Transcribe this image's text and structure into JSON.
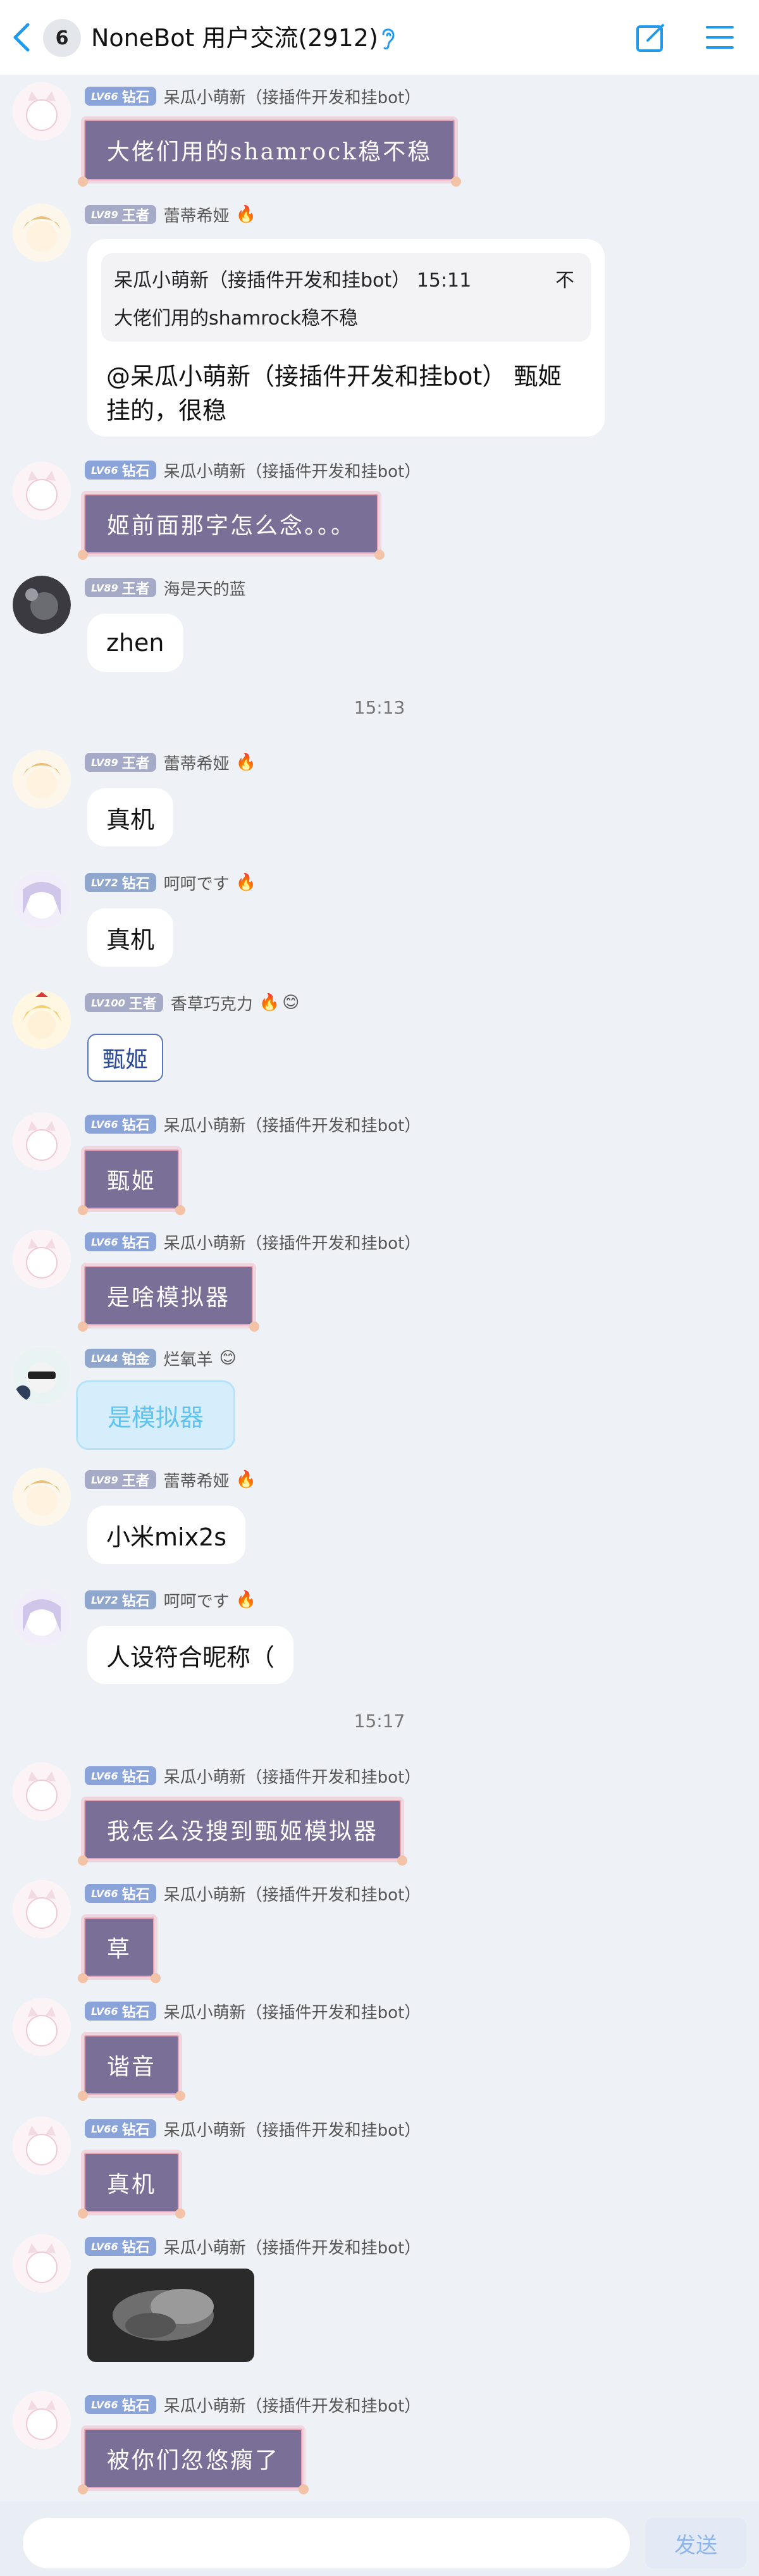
{
  "header": {
    "unread": "6",
    "title": "NoneBot 用户交流(2912)"
  },
  "colors": {
    "accent": "#1e9bf0",
    "background": "#eef1f6",
    "purple_bubble": "#7a6f96"
  },
  "messages": [
    {
      "level": "LV66",
      "rank": "钻石",
      "name": "呆瓜小萌新（接插件开发和挂bot）",
      "text": "大佬们用的shamrock稳不稳"
    },
    {
      "level": "LV89",
      "rank": "王者",
      "name": "蕾蒂希娅",
      "quote_head": "呆瓜小萌新（接插件开发和挂bot）  15:11",
      "quote_body": "大佬们用的shamrock稳不稳",
      "quote_no": "不",
      "text1": "@呆瓜小萌新（接插件开发和挂bot） 甄姬",
      "text2": "挂的，很稳"
    },
    {
      "level": "LV66",
      "rank": "钻石",
      "name": "呆瓜小萌新（接插件开发和挂bot）",
      "text": "姬前面那字怎么念。。。"
    },
    {
      "level": "LV89",
      "rank": "王者",
      "name": "海是天的蓝",
      "text": "zhen"
    },
    {
      "time": "15:13"
    },
    {
      "level": "LV89",
      "rank": "王者",
      "name": "蕾蒂希娅",
      "text": "真机"
    },
    {
      "level": "LV72",
      "rank": "钻石",
      "name": "呵呵です",
      "text": "真机"
    },
    {
      "level": "LV100",
      "rank": "王者",
      "name": "香草巧克力",
      "text": "甄姬"
    },
    {
      "level": "LV66",
      "rank": "钻石",
      "name": "呆瓜小萌新（接插件开发和挂bot）",
      "text": "甄姬"
    },
    {
      "level": "LV66",
      "rank": "钻石",
      "name": "呆瓜小萌新（接插件开发和挂bot）",
      "text": "是啥模拟器"
    },
    {
      "level": "LV44",
      "rank": "铂金",
      "name": "烂氧羊",
      "text": "是模拟器"
    },
    {
      "level": "LV89",
      "rank": "王者",
      "name": "蕾蒂希娅",
      "text": "小米mix2s"
    },
    {
      "level": "LV72",
      "rank": "钻石",
      "name": "呵呵です",
      "text": "人设符合昵称（"
    },
    {
      "time": "15:17"
    },
    {
      "level": "LV66",
      "rank": "钻石",
      "name": "呆瓜小萌新（接插件开发和挂bot）",
      "text": "我怎么没搜到甄姬模拟器"
    },
    {
      "level": "LV66",
      "rank": "钻石",
      "name": "呆瓜小萌新（接插件开发和挂bot）",
      "text": "草"
    },
    {
      "level": "LV66",
      "rank": "钻石",
      "name": "呆瓜小萌新（接插件开发和挂bot）",
      "text": "谐音"
    },
    {
      "level": "LV66",
      "rank": "钻石",
      "name": "呆瓜小萌新（接插件开发和挂bot）",
      "text": "真机"
    },
    {
      "level": "LV66",
      "rank": "钻石",
      "name": "呆瓜小萌新（接插件开发和挂bot）",
      "text": ""
    },
    {
      "level": "LV66",
      "rank": "钻石",
      "name": "呆瓜小萌新（接插件开发和挂bot）",
      "text": "被你们忽悠瘸了"
    }
  ],
  "composer": {
    "placeholder": "",
    "send_label": "发送"
  }
}
